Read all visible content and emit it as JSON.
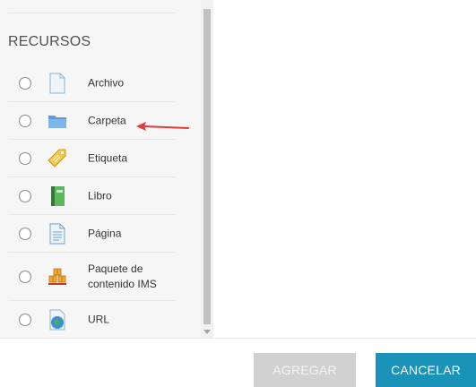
{
  "section": {
    "title": "RECURSOS"
  },
  "resources": [
    {
      "label": "Archivo",
      "icon": "file-icon"
    },
    {
      "label": "Carpeta",
      "icon": "folder-icon"
    },
    {
      "label": "Etiqueta",
      "icon": "tag-icon"
    },
    {
      "label": "Libro",
      "icon": "book-icon"
    },
    {
      "label": "Página",
      "icon": "page-icon"
    },
    {
      "label": "Paquete de contenido IMS",
      "icon": "package-icon"
    },
    {
      "label": "URL",
      "icon": "globe-icon"
    }
  ],
  "buttons": {
    "add": "AGREGAR",
    "cancel": "CANCELAR"
  },
  "colors": {
    "accent": "#1993b8",
    "disabled": "#d1d1d1",
    "annotation": "#e03a3a"
  }
}
